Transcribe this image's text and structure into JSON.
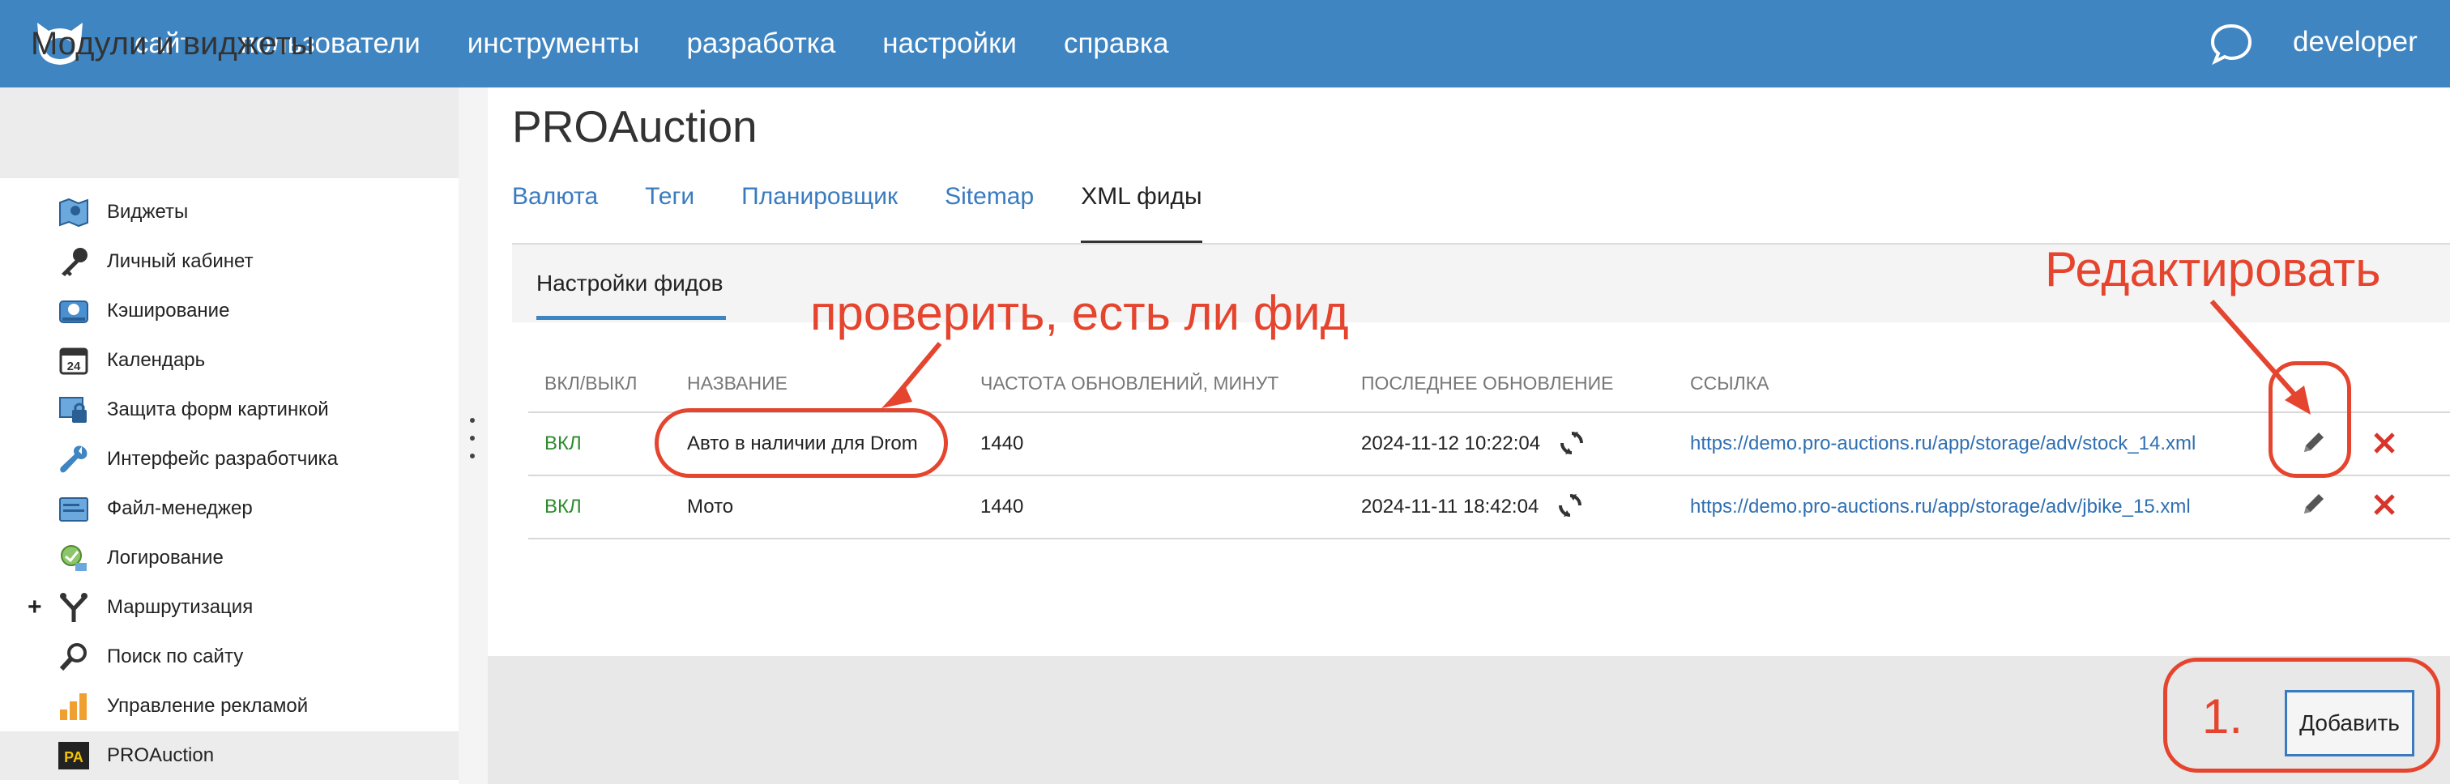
{
  "topbar": {
    "nav": [
      "сайт",
      "пользователи",
      "инструменты",
      "разработка",
      "настройки",
      "справка"
    ],
    "user": "developer",
    "color": "#3f85c2"
  },
  "sidebar": {
    "title": "Модули и виджеты",
    "items": [
      {
        "label": "Виджеты",
        "icon": "map-icon"
      },
      {
        "label": "Личный кабинет",
        "icon": "key-icon"
      },
      {
        "label": "Кэширование",
        "icon": "hard-drive-icon"
      },
      {
        "label": "Календарь",
        "icon": "calendar-icon",
        "badge": "24"
      },
      {
        "label": "Защита форм картинкой",
        "icon": "captcha-icon"
      },
      {
        "label": "Интерфейс разработчика",
        "icon": "wrench-icon"
      },
      {
        "label": "Файл-менеджер",
        "icon": "folder-icon"
      },
      {
        "label": "Логирование",
        "icon": "log-icon"
      },
      {
        "label": "Маршрутизация",
        "icon": "route-icon",
        "expand": "+"
      },
      {
        "label": "Поиск по сайту",
        "icon": "search-icon"
      },
      {
        "label": "Управление рекламой",
        "icon": "bar-chart-icon"
      },
      {
        "label": "PROAuction",
        "icon": "pa-icon",
        "badge": "PA",
        "active": true
      }
    ]
  },
  "main": {
    "title": "PROAuction",
    "tabs": [
      {
        "label": "Валюта"
      },
      {
        "label": "Теги"
      },
      {
        "label": "Планировщик"
      },
      {
        "label": "Sitemap"
      },
      {
        "label": "XML фиды",
        "active": true
      }
    ],
    "subtab": "Настройки фидов",
    "table": {
      "columns": [
        "ВКЛ/ВЫКЛ",
        "НАЗВАНИЕ",
        "ЧАСТОТА ОБНОВЛЕНИЙ, МИНУТ",
        "ПОСЛЕДНЕЕ ОБНОВЛЕНИЕ",
        "ССЫЛКА"
      ],
      "rows": [
        {
          "status": "ВКЛ",
          "name": "Авто в наличии для Drom",
          "frequency": "1440",
          "updated": "2024-11-12 10:22:04",
          "url": "https://demo.pro-auctions.ru/app/storage/adv/stock_14.xml"
        },
        {
          "status": "ВКЛ",
          "name": "Мото",
          "frequency": "1440",
          "updated": "2024-11-11 18:42:04",
          "url": "https://demo.pro-auctions.ru/app/storage/adv/jbike_15.xml"
        }
      ]
    },
    "add_label": "Добавить"
  },
  "annotations": {
    "check": "проверить, есть ли фид",
    "edit": "Редактировать",
    "step": "1.",
    "color": "#e5452e"
  }
}
